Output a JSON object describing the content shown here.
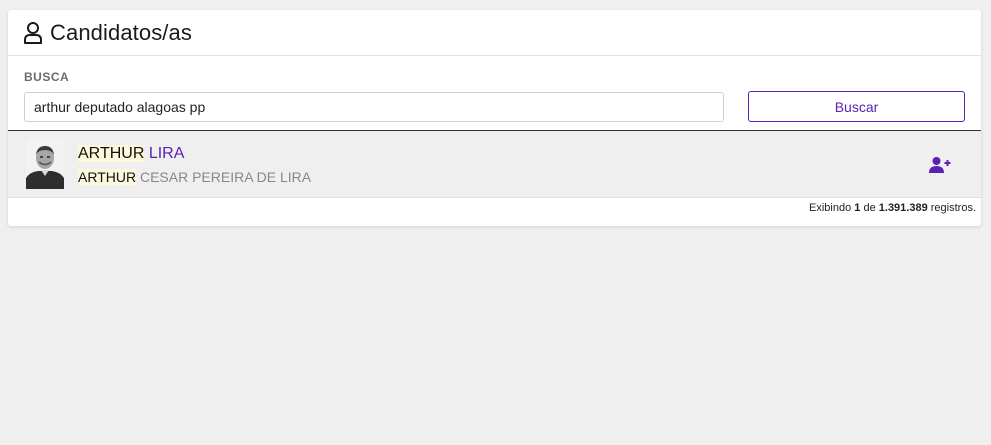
{
  "header": {
    "title": "Candidatos/as",
    "icon": "user-outline-icon"
  },
  "search": {
    "label": "BUSCA",
    "value": "arthur deputado alagoas pp",
    "button_label": "Buscar"
  },
  "results": [
    {
      "name_highlight": "ARTHUR",
      "name_rest": " LIRA",
      "full_name_highlight": "ARTHUR",
      "full_name_rest": " CESAR PEREIRA DE LIRA",
      "action_icon": "user-plus-icon"
    }
  ],
  "footer": {
    "prefix": "Exibindo ",
    "shown": "1",
    "middle": " de ",
    "total": "1.391.389",
    "suffix": " registros."
  },
  "colors": {
    "accent": "#5b21b6",
    "highlight": "#fdf8dc",
    "background": "#efefef"
  }
}
